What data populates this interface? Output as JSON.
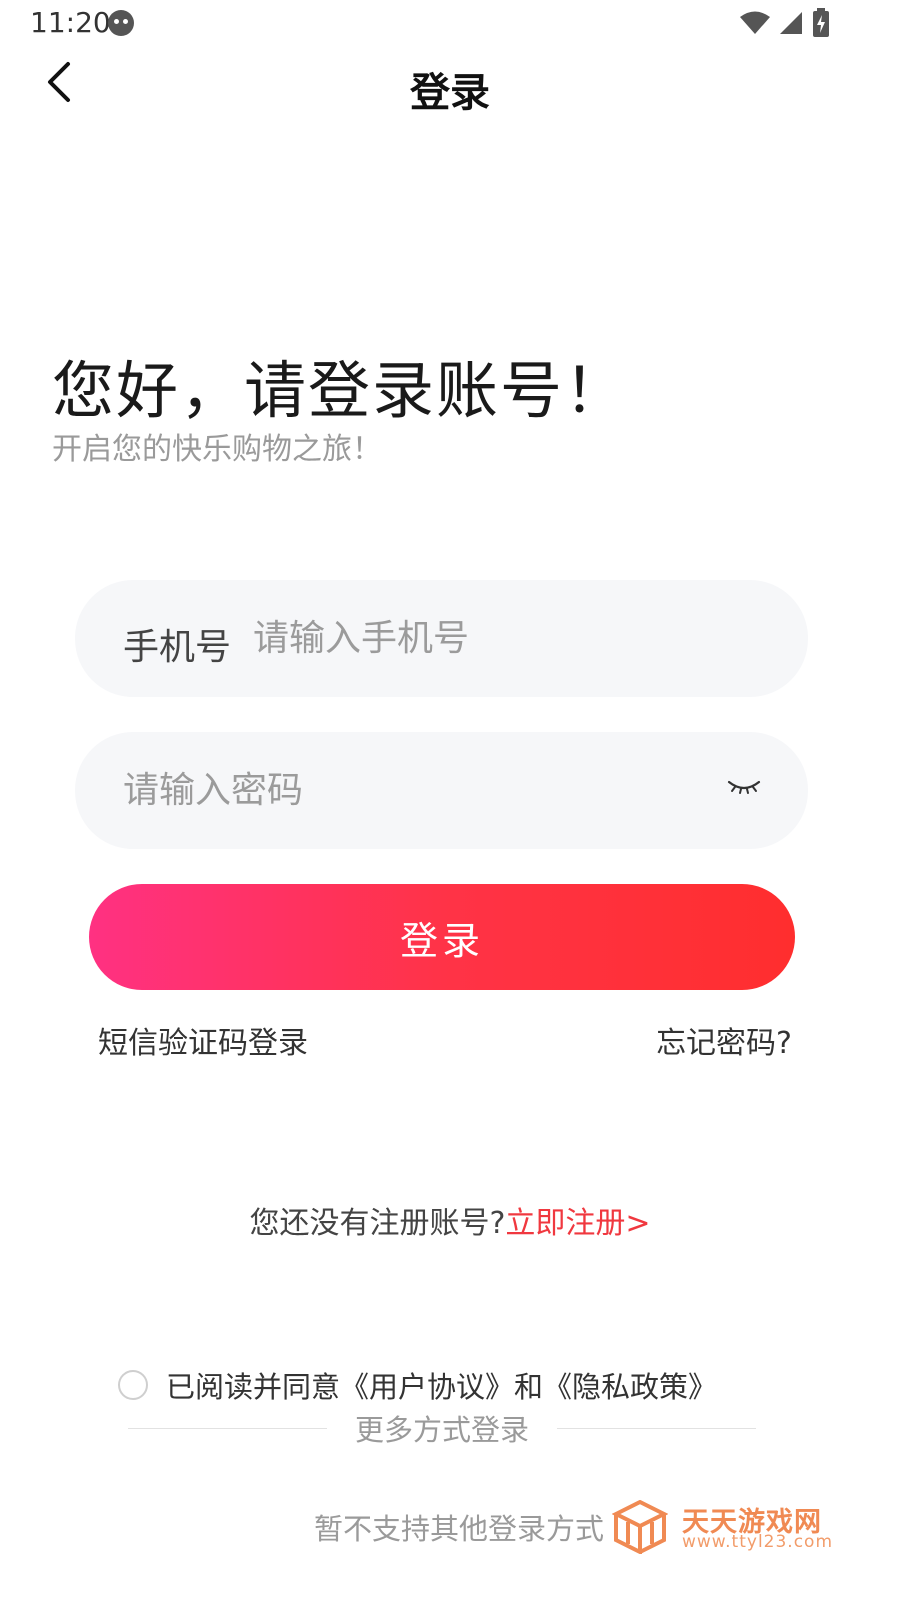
{
  "status_bar": {
    "time": "11:20"
  },
  "nav": {
    "title": "登录"
  },
  "greeting": {
    "title": "您好，请登录账号！",
    "subtitle": "开启您的快乐购物之旅！"
  },
  "phone_field": {
    "label": "手机号",
    "value": "",
    "placeholder": "请输入手机号"
  },
  "password_field": {
    "value": "",
    "placeholder": "请输入密码"
  },
  "login_button": {
    "label": "登录"
  },
  "links": {
    "sms_login": "短信验证码登录",
    "forgot_password": "忘记密码?"
  },
  "register": {
    "prompt": "您还没有注册账号?",
    "link": "立即注册>"
  },
  "agreement": {
    "text": "已阅读并同意《用户协议》和《隐私政策》",
    "checked": false
  },
  "more_login": {
    "label": "更多方式登录",
    "unsupported": "暂不支持其他登录方式"
  },
  "watermark": {
    "title": "天天游戏网",
    "url": "www.ttyl23.com"
  },
  "colors": {
    "accent_start": "#ff3182",
    "accent_end": "#ff2e2e",
    "link_red": "#f0383f",
    "watermark_orange": "#f08a53"
  }
}
